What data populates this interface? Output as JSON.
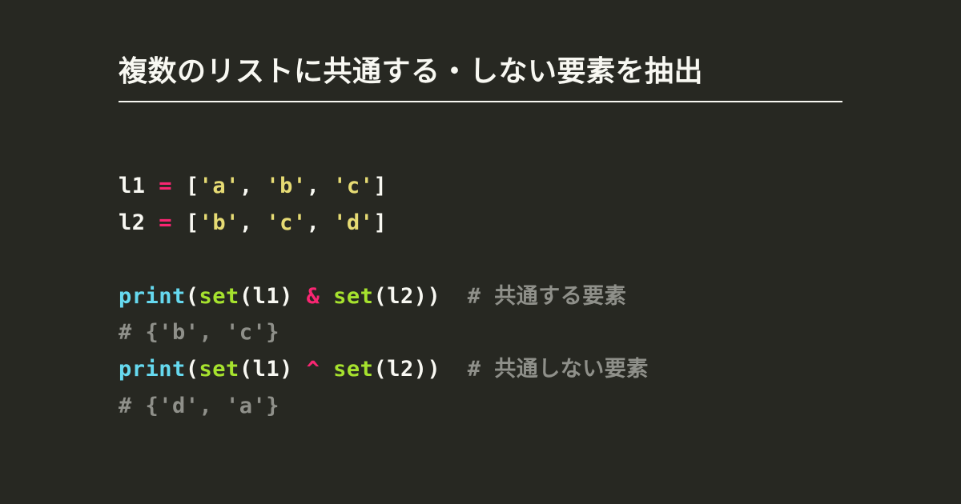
{
  "title": "複数のリストに共通する・しない要素を抽出",
  "code": {
    "l1var": "l1 ",
    "l2var": "l2 ",
    "eq": "=",
    "sp": " ",
    "lbr": "[",
    "rbr": "]",
    "comma": ", ",
    "lp": "(",
    "rp": "))",
    "rp1": ") ",
    "a": "'a'",
    "b": "'b'",
    "c": "'c'",
    "d": "'d'",
    "print": "print",
    "set": "set",
    "amp": "&",
    "xor": "^",
    "l1": "l1",
    "l2": "l2",
    "gap1": "  ",
    "gap2": "  ",
    "comment1": "# 共通する要素",
    "comment2": "# {'b', 'c'}",
    "comment3": "# 共通しない要素",
    "comment4": "# {'d', 'a'}"
  }
}
